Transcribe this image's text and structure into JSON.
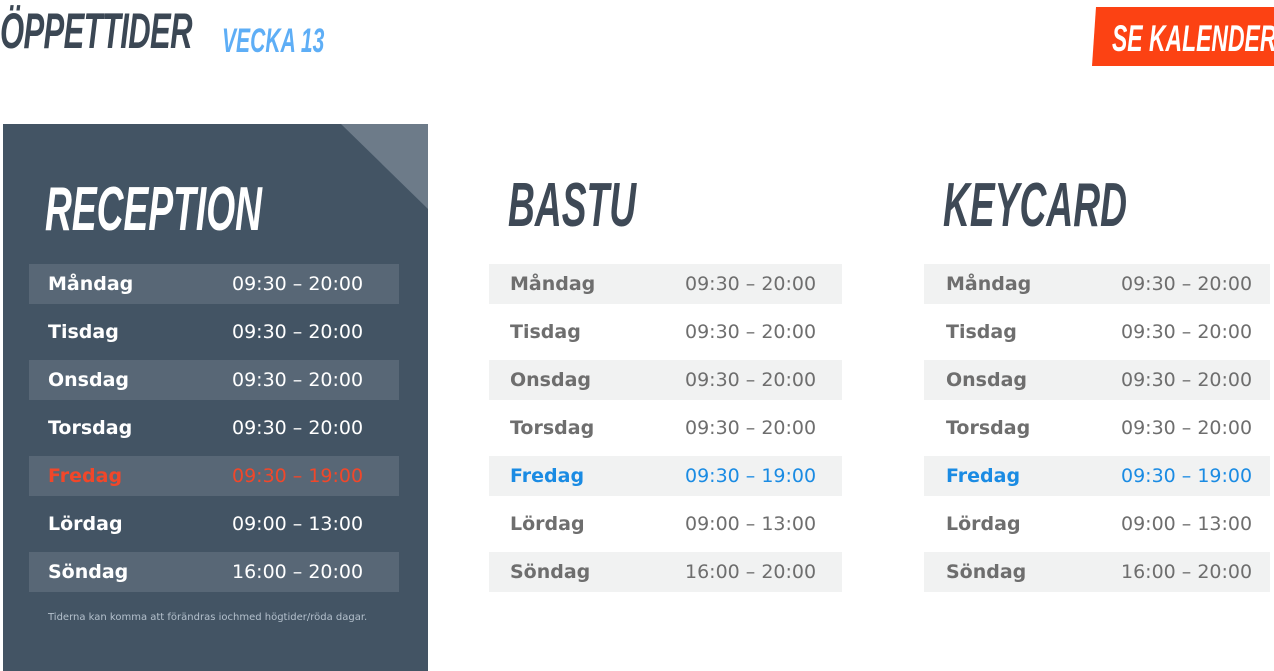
{
  "header": {
    "title": "ÖPPETTIDER",
    "week": "VECKA 13",
    "calendar_button": "SE KALENDER"
  },
  "colors": {
    "brand_dark": "#435464",
    "accent_orange": "#fc4213",
    "highlight_red": "#f1472a",
    "highlight_blue": "#1a8be3",
    "week_blue": "#5eaef6"
  },
  "reception": {
    "title": "RECEPTION",
    "note": "Tiderna kan komma att förändras iochmed högtider/röda dagar.",
    "rows": [
      {
        "day": "Måndag",
        "time": "09:30 – 20:00"
      },
      {
        "day": "Tisdag",
        "time": "09:30 – 20:00"
      },
      {
        "day": "Onsdag",
        "time": "09:30 – 20:00"
      },
      {
        "day": "Torsdag",
        "time": "09:30 – 20:00"
      },
      {
        "day": "Fredag",
        "time": "09:30 – 19:00"
      },
      {
        "day": "Lördag",
        "time": "09:00 – 13:00"
      },
      {
        "day": "Söndag",
        "time": "16:00 – 20:00"
      }
    ]
  },
  "bastu": {
    "title": "BASTU",
    "rows": [
      {
        "day": "Måndag",
        "time": "09:30 – 20:00"
      },
      {
        "day": "Tisdag",
        "time": "09:30 – 20:00"
      },
      {
        "day": "Onsdag",
        "time": "09:30 – 20:00"
      },
      {
        "day": "Torsdag",
        "time": "09:30 – 20:00"
      },
      {
        "day": "Fredag",
        "time": "09:30 – 19:00"
      },
      {
        "day": "Lördag",
        "time": "09:00 – 13:00"
      },
      {
        "day": "Söndag",
        "time": "16:00 – 20:00"
      }
    ]
  },
  "keycard": {
    "title": "KEYCARD",
    "rows": [
      {
        "day": "Måndag",
        "time": "09:30 – 20:00"
      },
      {
        "day": "Tisdag",
        "time": "09:30 – 20:00"
      },
      {
        "day": "Onsdag",
        "time": "09:30 – 20:00"
      },
      {
        "day": "Torsdag",
        "time": "09:30 – 20:00"
      },
      {
        "day": "Fredag",
        "time": "09:30 – 19:00"
      },
      {
        "day": "Lördag",
        "time": "09:00 – 13:00"
      },
      {
        "day": "Söndag",
        "time": "16:00 – 20:00"
      }
    ]
  }
}
